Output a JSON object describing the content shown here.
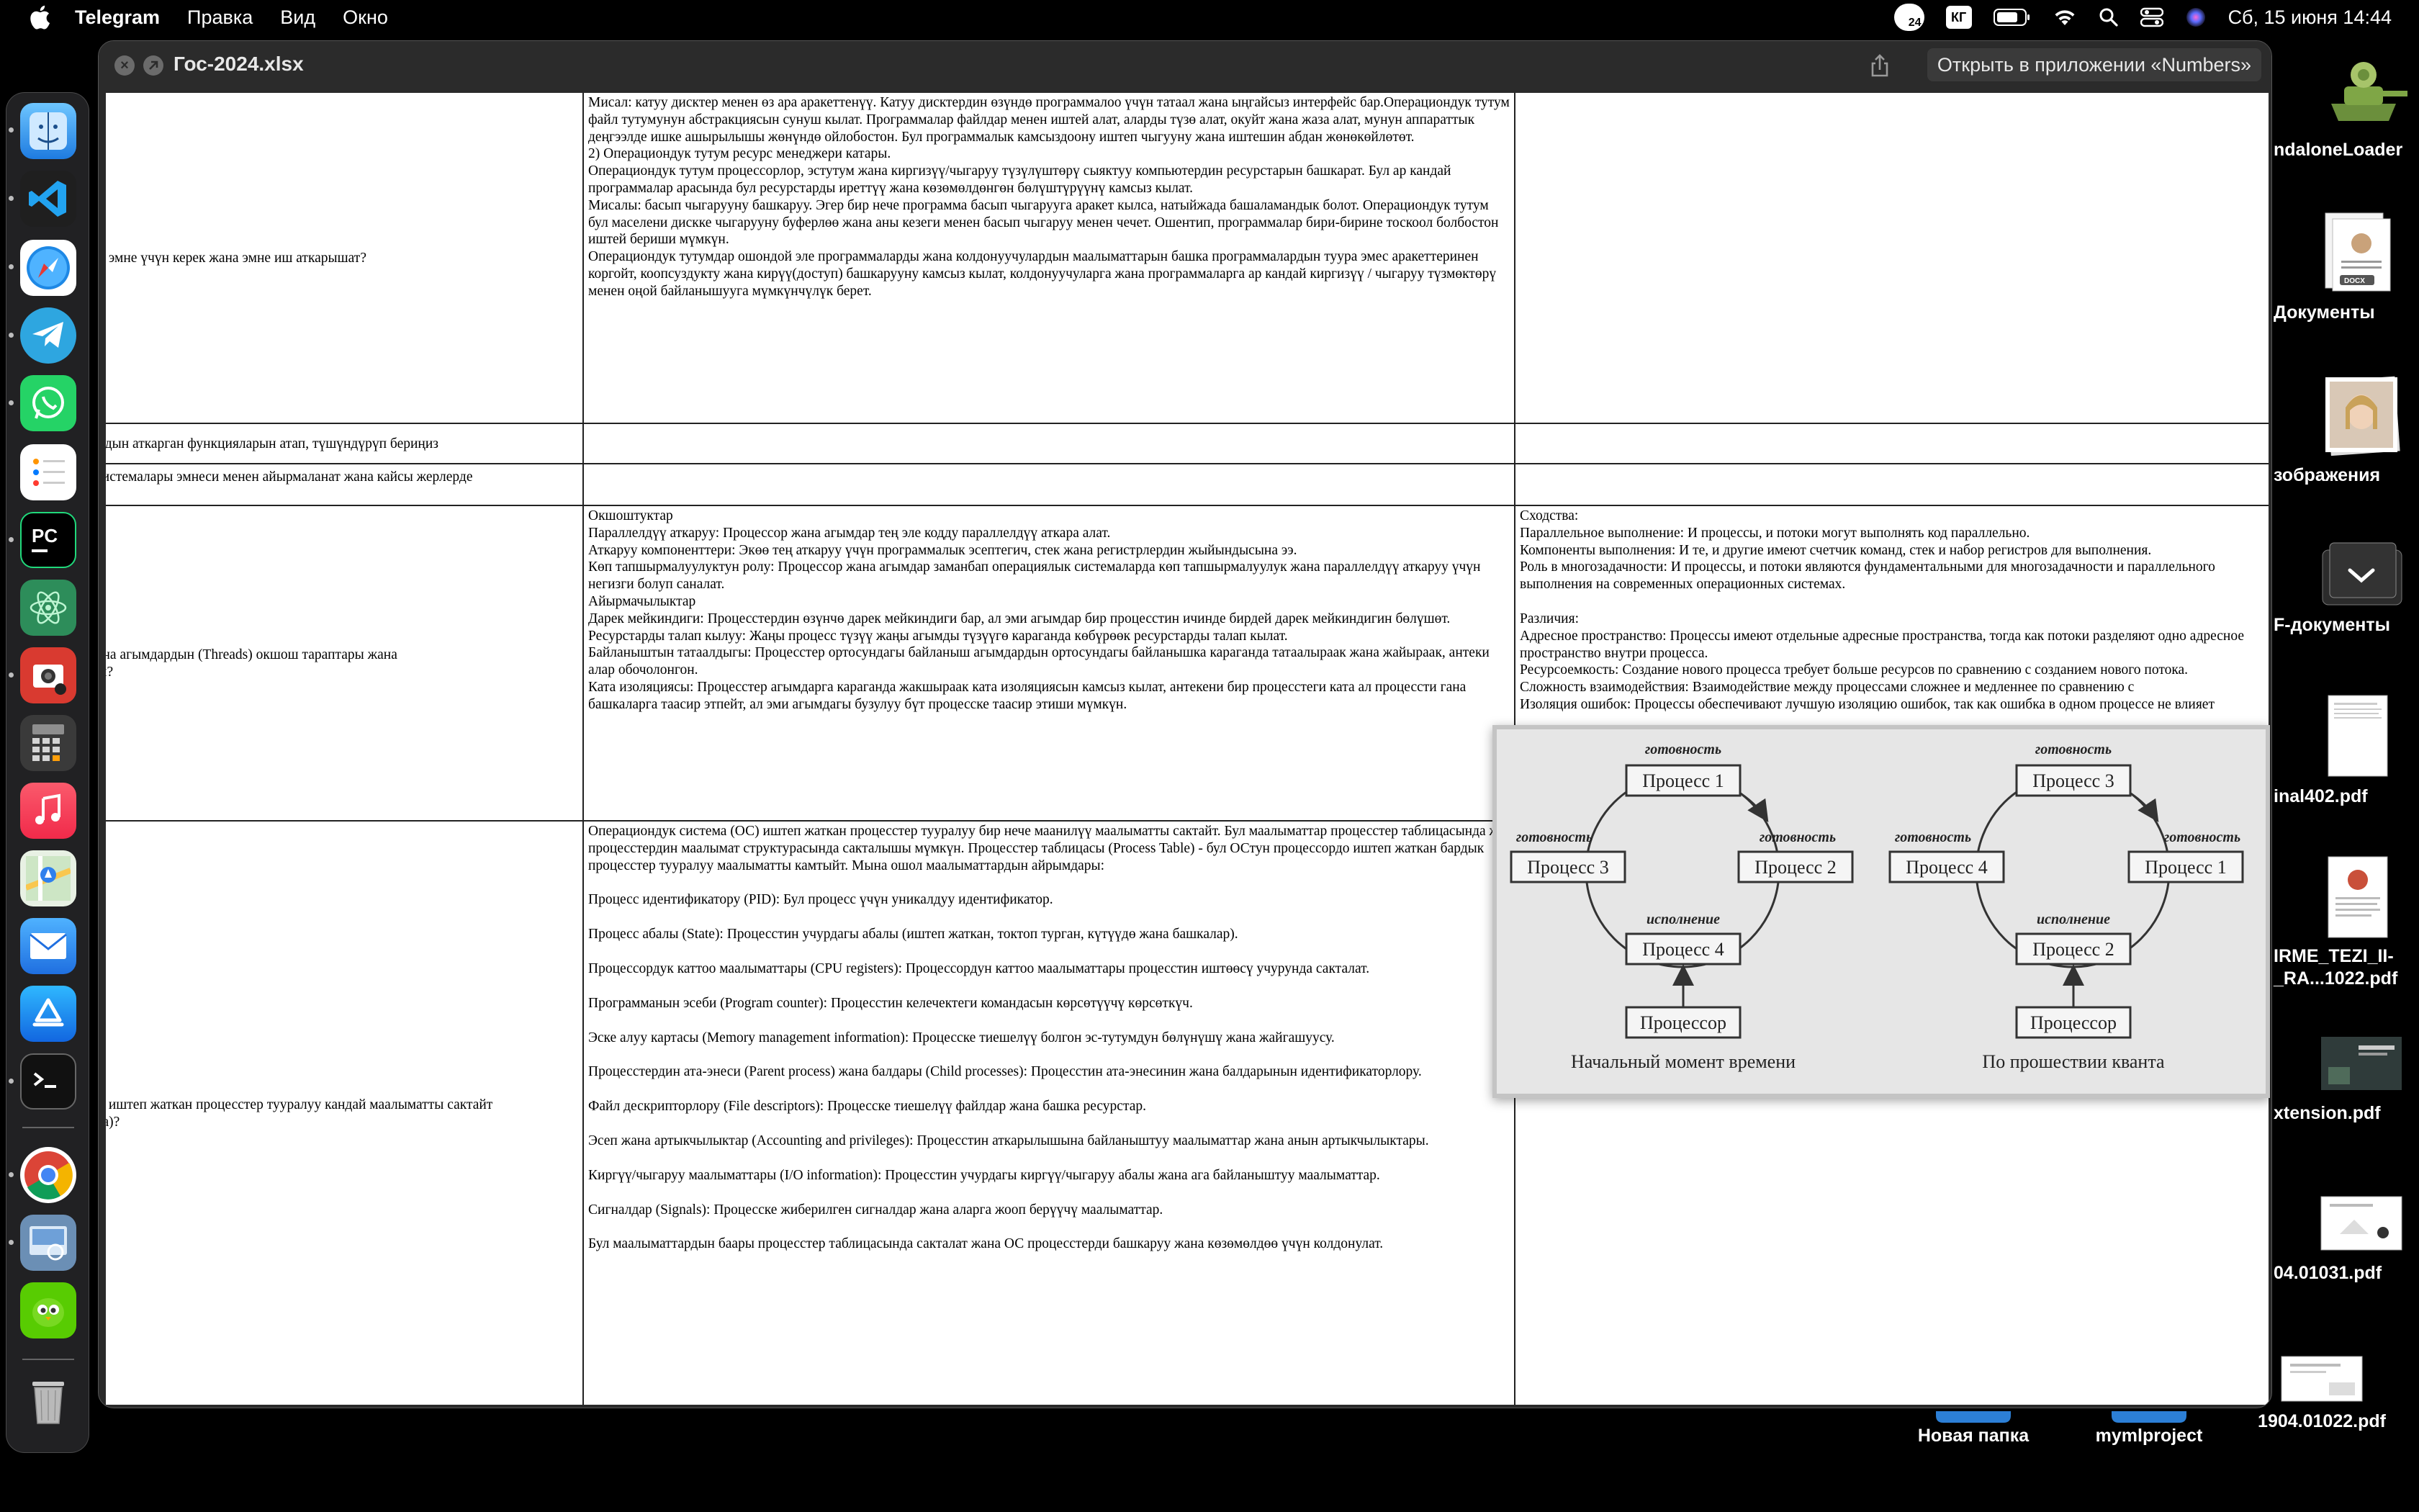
{
  "menubar": {
    "app_name": "Telegram",
    "items": [
      "Правка",
      "Вид",
      "Окно"
    ],
    "notif_count": "24",
    "keyboard_layout": "КГ",
    "datetime": "Сб, 15 июня  14:44"
  },
  "window": {
    "title": "Гос-2024.xlsx",
    "open_button": "Открыть в приложении «Numbers»"
  },
  "sheet": {
    "row1": {
      "q": "алар эмне үчүн керек жана эмне иш аткарышат?",
      "a": [
        "Мисал: катуу дисктер менен өз ара аракеттенүү. Катуу дисктердин өзүндө программалоо үчүн татаал жана ыңгайсыз интерфейс бар.Операциондук тутум файл тутумунун абстракциясын сунуш кылат. Программалар файлдар менен иштей алат, аларды түзө алат, окуйт жана жаза алат, мунун аппараттык деңгээлде ишке ашырылышы жөнүндө ойлобостон. Бул программалык камсыздоону иштеп чыгууну жана иштешин абдан жөнөкөйлөтөт.",
        "2) Операциондук тутум ресурс менеджери катары.",
        "Операциондук тутум процессорлор, эстутум жана киргизүү/чыгаруу түзүлүштөрү сыяктуу компьютердин ресурстарын башкарат. Бул ар кандай программалар арасында бул ресурстарды ирeттүү жана көзөмөлдөнгөн бөлүштүрүүнү камсыз кылат.",
        "Мисалы: басып чыгарууну башкаруу. Эгер бир нече программа басып чыгарууга аракет кылса, натыйжада башаламандык болот. Операциондук тутум бул маселени дискке чыгарууну буферлөө жана аны кезеги менен басып чыгаруу менен чечет. Ошентип, программалар бири-бирине тоскоол болбостон иштей бериши мүмкүн.",
        "Операциондук тутумдар ошондой эле программаларды жана колдонуучулардын маалыматтарын башка программалардын туура эмес аракеттеринен коргойт, коопсуздукту жана кирүү(доступ) башкарууну камсыз кылат, колдонуучуларга жана программаларга ар кандай киргизүү / чыгаруу түзмөктөрү менен оңой байланышууга мүмкүнчүлүк берет."
      ]
    },
    "row2": {
      "q": "алардын аткарган функцияларын атап, түшүндүрүп бериңиз"
    },
    "row3": {
      "q": [
        "ук системалары эмнеси менен айырмаланат жана кайсы жерлерде",
        "?"
      ]
    },
    "row4": {
      "q": [
        ") жана агымдардын (Threads) окшош тараптары жана",
        "ндай?"
      ],
      "a": [
        "Окшоштуктар",
        "Параллелдүү аткаруу: Процессор жана агымдар тең эле кодду параллелдүү аткара алат.",
        "Аткаруу компоненттери: Экөө тең аткаруу үчүн программалык эсептегич, стек жана регистрлердин жыйындысына ээ.",
        "Көп тапшырмалуулуктун ролу: Процессор жана агымдар заманбап операциялык системаларда көп тапшырмалуулук жана параллелдүү аткаруу үчүн негизги болуп саналат.",
        "Айырмачылыктар",
        "Дарек мейкиндиги: Процесстердин өзүнчө дарек мейкиндиги бар, ал эми агымдар бир процесстин ичинде бирдей дарек мейкиндигин бөлүшөт.",
        "Ресурстарды талап кылуу: Жаңы процесс түзүү жаңы агымды түзүүгө караганда көбүрөөк ресурстарды талап кылат.",
        "Байланыштын татаалдыгы: Процесстер ортосундагы байланыш агымдардын ортосундагы байланышка караганда татаалыраак жана жайыраак, антеки алар обочолонгон.",
        "Ката изоляциясы: Процесстер агымдарга караганда жакшыраак ката изоляциясын камсыз кылат, антекени бир процесстеги ката ал процессти гана башкаларга таасир этпейт, ал эми агымдагы бузулуу бүт процесске таасир этиши мүмкүн."
      ],
      "r": [
        "Сходства:",
        "Параллельное выполнение: И процессы, и потоки могут выполнять код параллельно.",
        "Компоненты выполнения: И те, и другие имеют счетчик команд, стек и набор регистров для выполнения.",
        "Роль в многозадачности: И процессы, и потоки являются фундаментальными для многозадачности и параллельного выполнения на современных операционных системах.",
        "",
        "Различия:",
        "Адресное пространство: Процессы имеют отдельные адресные пространства, тогда как потоки разделяют одно адресное пространство внутри процесса.",
        "Ресурсоемкость: Создание нового процесса требует больше ресурсов по сравнению с созданием нового потока.",
        "Сложность взаимодействия: Взаимодействие между процессами сложнее и медленнее по сравнению с",
        "Изоляция ошибок: Процессы обеспечивают лучшую изоляцию ошибок, так как ошибка в одном процессе не влияет"
      ]
    },
    "row5": {
      "q": [
        "алар иштеп жаткан процесстер тууралуу кандай маалыматты сактайт",
        "ында)?"
      ],
      "a": [
        "Операциондук система (ОС) иштеп жаткан процесстер тууралуу бир нече маанилүү маалыматты сактайт. Бул маалыматтар процесстер таблицасында же процесстердин маалымат структурасында сакталышы мүмкүн. Процесстер таблицасы (Process Table) - бул ОСтун процессордо иштеп жаткан бардык процесстер тууралуу маалыматты камтыйт. Мына ошол маалыматтардын айрымдары:",
        "",
        "Процесс идентификатору (PID): Бул процесс үчүн уникалдуу идентификатор.",
        "",
        "Процесс абалы (State): Процесстин учурдагы абалы (иштеп жаткан, токтоп турган, күтүүдө жана башкалар).",
        "",
        "Процессордук каттоо маалыматтары (CPU registers): Процессордун каттоо маалыматтары процесстин иштөөсү учурунда сакталат.",
        "",
        "Программанын эсеби (Program counter): Процесстин келечектеги командасын көрсөтүүчү көрсөткүч.",
        "",
        "Эске алуу картасы (Memory management information): Процесске тиешелүү болгон эс-тутумдун бөлүнүшү жана жайгашуусу.",
        "",
        "Процесстердин ата-энеси (Parent process) жана балдары (Child processes): Процесстин ата-энесинин жана балдарынын идентификаторлору.",
        "",
        "Файл дескрипторлору (File descriptors): Процесске тиешелүү файлдар жана башка ресурстар.",
        "",
        "Эсеп жана артыкчылыктар (Accounting and privileges): Процесстин аткарылышына байланыштуу маалыматтар жана анын артыкчылыктары.",
        "",
        "Киргүү/чыгаруу маалыматтары (I/O information): Процесстин учурдагы киргүү/чыгаруу абалы жана ага байланыштуу маалыматтар.",
        "",
        "Сигналдар (Signals): Процесске жиберилген сигналдар жана аларга жооп берүүчү маалыматтар.",
        "",
        "Бул маалыматтардын баары процесстер таблицасында сакталат жана ОС процесстерди башкаруу жана көзөмөлдөө үчүн колдонулат."
      ]
    }
  },
  "diagram": {
    "left": {
      "top": "Процесс 1",
      "left": "Процесс 3",
      "right": "Процесс 2",
      "bottom": "Процесс 4",
      "label_top": "готовность",
      "label_left": "готовность",
      "label_right": "готовность",
      "label_bottom": "исполнение",
      "cpu": "Процессор",
      "caption": "Начальный момент времени"
    },
    "right": {
      "top": "Процесс 3",
      "left": "Процесс 4",
      "right": "Процесс 1",
      "bottom": "Процесс 2",
      "label_top": "готовность",
      "label_left": "готовность",
      "label_right": "готовность",
      "label_bottom": "исполнение",
      "cpu": "Процессор",
      "caption": "По прошествии кванта"
    }
  },
  "desktop": {
    "items": [
      {
        "label": "ndaloneLoader"
      },
      {
        "label": "Документы"
      },
      {
        "label": "зображения"
      },
      {
        "label": "F-документы"
      },
      {
        "label": "inal402.pdf"
      },
      {
        "label": "IRME_TEZI_II-"
      },
      {
        "label": "_RA...1022.pdf"
      },
      {
        "label": "xtension.pdf"
      },
      {
        "label": "04.01031.pdf"
      },
      {
        "label": "Новая папка"
      },
      {
        "label": "mymlproject"
      },
      {
        "label": "1904.01022.pdf"
      }
    ],
    "doc_thumb_text": "DOCX"
  },
  "dock": {
    "apps": [
      "finder-icon",
      "vscode-icon",
      "safari-icon",
      "telegram-icon",
      "whatsapp-icon",
      "reminders-icon",
      "pycharm-icon",
      "atom-icon",
      "photo-booth-icon",
      "calculator-icon",
      "music-icon",
      "maps-icon",
      "mail-icon",
      "app-store-icon",
      "terminal-icon",
      "chrome-icon",
      "preview-icon",
      "duolingo-icon",
      "trash-icon"
    ],
    "pycharm_text": "PC"
  },
  "colors": {
    "background": "#000000",
    "window": "#2a2a2a",
    "sheet": "#ffffff",
    "diagram_bg": "#e6e6e6"
  }
}
